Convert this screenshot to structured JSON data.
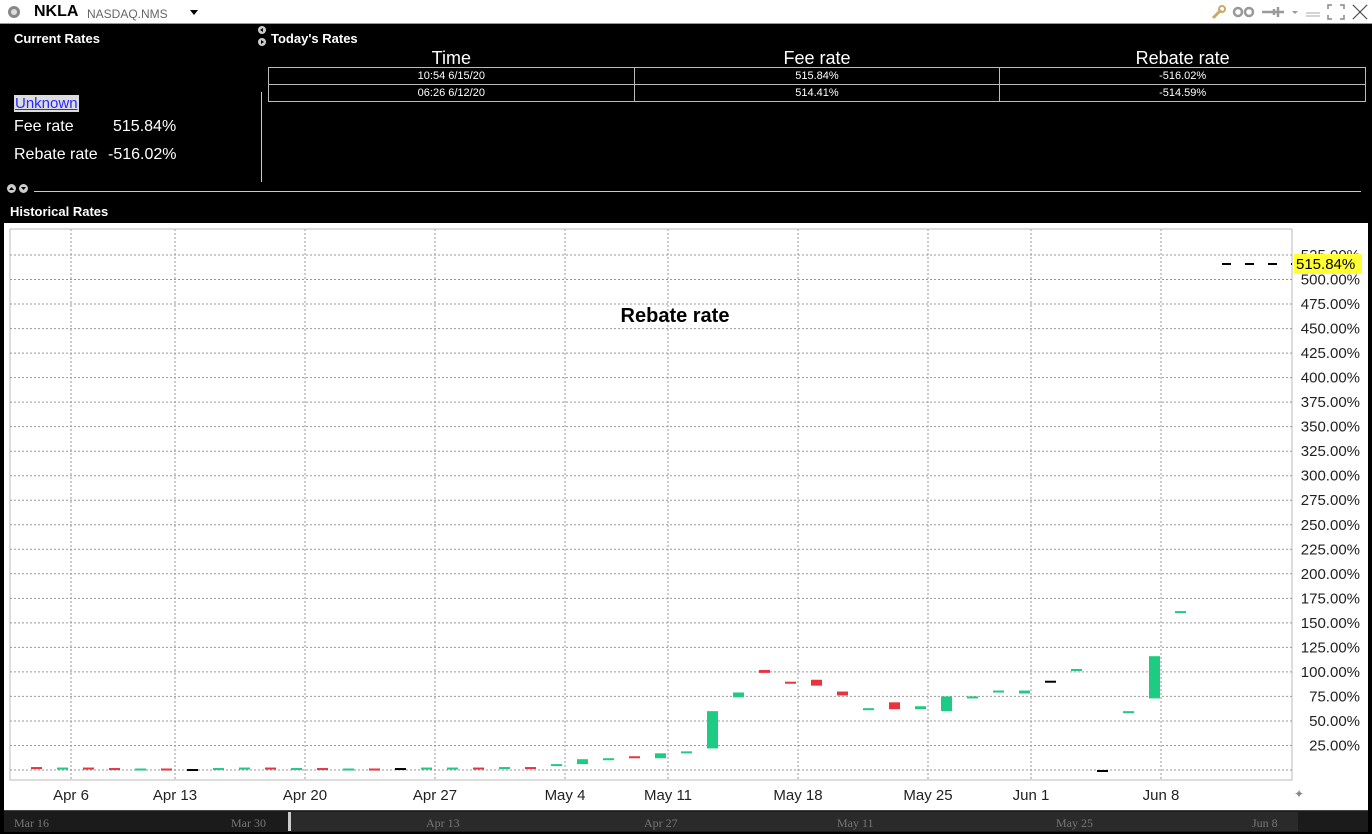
{
  "titlebar": {
    "symbol": "NKLA",
    "exchange": "NASDAQ.NMS",
    "icons": [
      "app-icon",
      "wrench-icon",
      "glasses-icon",
      "pin-icon",
      "menu-dropdown-icon",
      "minimize-icon",
      "maximize-icon",
      "close-icon"
    ]
  },
  "current_rates": {
    "title": "Current Rates",
    "status_link": "Unknown",
    "fee_label": "Fee rate",
    "fee_value": "515.84%",
    "rebate_label": "Rebate rate",
    "rebate_value": "-516.02%"
  },
  "todays_rates": {
    "title": "Today's Rates",
    "columns": [
      "Time",
      "Fee rate",
      "Rebate rate"
    ],
    "rows": [
      [
        "10:54  6/15/20",
        "515.84%",
        "-516.02%"
      ],
      [
        "06:26  6/12/20",
        "514.41%",
        "-514.59%"
      ]
    ]
  },
  "historical": {
    "title": "Historical Rates"
  },
  "chart_data": {
    "type": "candlestick",
    "title": "Rebate rate",
    "current_value_label": "515.84%",
    "colors": {
      "up": "#1ecb83",
      "down": "#e8343f",
      "flat": "#000000",
      "highlight": "#ffff33"
    },
    "ylim": [
      0,
      535
    ],
    "y_ticks": [
      "25.00%",
      "50.00%",
      "75.00%",
      "100.00%",
      "125.00%",
      "150.00%",
      "175.00%",
      "200.00%",
      "225.00%",
      "250.00%",
      "275.00%",
      "300.00%",
      "325.00%",
      "350.00%",
      "375.00%",
      "400.00%",
      "425.00%",
      "450.00%",
      "475.00%",
      "500.00%",
      "525.00%"
    ],
    "x_ticks": [
      {
        "day": 6,
        "label": "Apr 6"
      },
      {
        "day": 13,
        "label": "Apr 13"
      },
      {
        "day": 20,
        "label": "Apr 20"
      },
      {
        "day": 27,
        "label": "Apr 27"
      },
      {
        "day": 34,
        "label": "May 4"
      },
      {
        "day": 41,
        "label": "May 11"
      },
      {
        "day": 48,
        "label": "May 18"
      },
      {
        "day": 55,
        "label": "May 25"
      },
      {
        "day": 61,
        "label": "Jun 1"
      },
      {
        "day": 68,
        "label": "Jun 8"
      }
    ],
    "candles": [
      {
        "d": 1,
        "o": 3,
        "c": 2
      },
      {
        "d": 2,
        "o": 2,
        "c": 2.5
      },
      {
        "d": 3,
        "o": 2.5,
        "c": 1.5
      },
      {
        "d": 4,
        "o": 2,
        "c": 1
      },
      {
        "d": 5,
        "o": 1,
        "c": 1.5
      },
      {
        "d": 6,
        "o": 1.5,
        "c": 1
      },
      {
        "d": 7,
        "o": 1,
        "c": 1
      },
      {
        "d": 8,
        "o": 1,
        "c": 2
      },
      {
        "d": 9,
        "o": 2,
        "c": 2.5
      },
      {
        "d": 10,
        "o": 2.5,
        "c": 1.5
      },
      {
        "d": 11,
        "o": 1.5,
        "c": 2
      },
      {
        "d": 12,
        "o": 2,
        "c": 1
      },
      {
        "d": 13,
        "o": 1,
        "c": 1.5
      },
      {
        "d": 14,
        "o": 1.5,
        "c": 1
      },
      {
        "d": 15,
        "o": 2,
        "c": 2
      },
      {
        "d": 16,
        "o": 2,
        "c": 2.5
      },
      {
        "d": 17,
        "o": 2,
        "c": 2.5
      },
      {
        "d": 18,
        "o": 2.5,
        "c": 2
      },
      {
        "d": 19,
        "o": 2,
        "c": 3
      },
      {
        "d": 20,
        "o": 3,
        "c": 2
      },
      {
        "d": 21,
        "o": 4,
        "c": 6
      },
      {
        "d": 22,
        "o": 6,
        "c": 11
      },
      {
        "d": 23,
        "o": 10,
        "c": 12
      },
      {
        "d": 24,
        "o": 14,
        "c": 12
      },
      {
        "d": 25,
        "o": 12,
        "c": 17
      },
      {
        "d": 26,
        "o": 17,
        "c": 19
      },
      {
        "d": 27,
        "o": 22,
        "c": 60
      },
      {
        "d": 28,
        "o": 74,
        "c": 79
      },
      {
        "d": 29,
        "o": 102,
        "c": 99
      },
      {
        "d": 30,
        "o": 90,
        "c": 88
      },
      {
        "d": 31,
        "o": 92,
        "c": 86
      },
      {
        "d": 32,
        "o": 80,
        "c": 76
      },
      {
        "d": 33,
        "o": 61,
        "c": 63
      },
      {
        "d": 34,
        "o": 69,
        "c": 62
      },
      {
        "d": 35,
        "o": 62,
        "c": 65
      },
      {
        "d": 36,
        "o": 60,
        "c": 75
      },
      {
        "d": 37,
        "o": 73,
        "c": 75
      },
      {
        "d": 38,
        "o": 79,
        "c": 81
      },
      {
        "d": 39,
        "o": 78,
        "c": 81
      },
      {
        "d": 40,
        "o": 91,
        "c": 91
      },
      {
        "d": 41,
        "o": 101,
        "c": 103
      },
      {
        "d": 42,
        "o": 0,
        "c": 0
      },
      {
        "d": 43,
        "o": 59,
        "c": 60
      },
      {
        "d": 44,
        "o": 73,
        "c": 116
      },
      {
        "d": 45,
        "o": 161,
        "c": 162
      }
    ],
    "dashed_last": {
      "value": 515.84
    }
  },
  "scrollbar": {
    "labels": [
      "Mar 16",
      "Mar 30",
      "Apr 13",
      "Apr 27",
      "May 11",
      "May 25",
      "Jun 8"
    ]
  }
}
